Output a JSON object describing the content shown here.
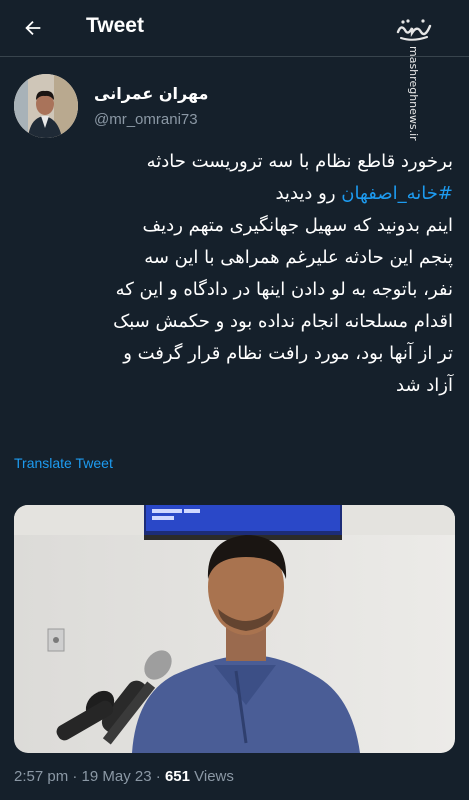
{
  "header": {
    "title": "Tweet",
    "back_icon": "arrow-left-icon"
  },
  "watermark": {
    "logo_text": "مشرق",
    "site": "mashreghnews.ir"
  },
  "author": {
    "name": "مهران عمرانی",
    "handle": "@mr_omrani73"
  },
  "tweet": {
    "line1": "برخورد قاطع نظام با سه تروریست حادثه",
    "hashtag": "#خانه_اصفهان",
    "line2_rest": " رو دیدید",
    "line3": "اینم بدونید که سهیل جهانگیری متهم ردیف",
    "line4": "پنجم این حادثه علیرغم همراهی با این سه",
    "line5": "نفر، باتوجه به لو دادن اینها در دادگاه و این که",
    "line6": "اقدام مسلحانه انجام نداده بود و حکمش سبک",
    "line7": "تر از آنها بود، مورد رافت نظام قرار گرفت و",
    "line8": "آزاد شد"
  },
  "translate_label": "Translate Tweet",
  "meta": {
    "time": "2:57 pm",
    "sep": " · ",
    "date": "19 May 23",
    "views_count": "651",
    "views_label": " Views"
  },
  "colors": {
    "background": "#15202b",
    "link": "#1d9bf0",
    "secondary_text": "#8b98a5",
    "divider": "#38444d"
  }
}
